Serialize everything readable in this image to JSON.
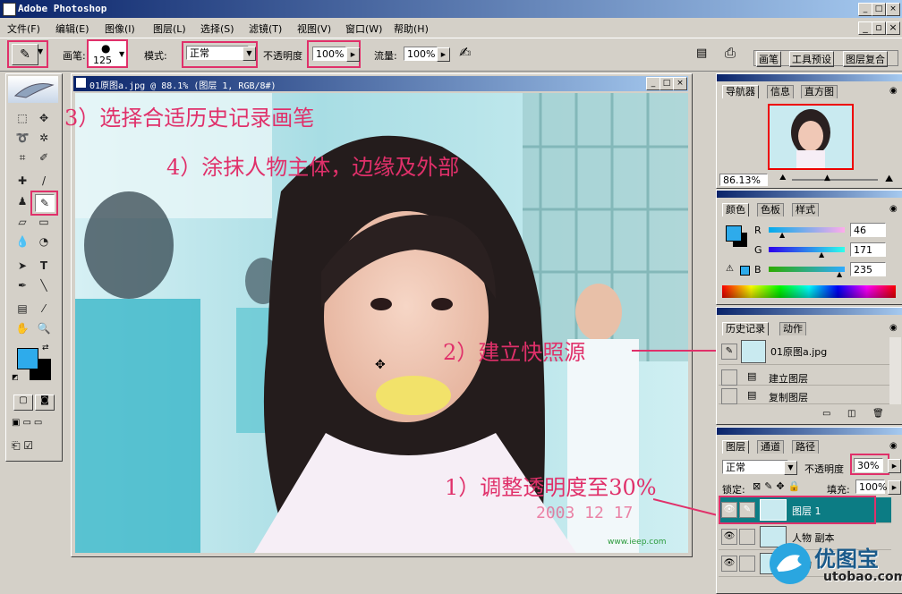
{
  "window": {
    "title": "Adobe Photoshop"
  },
  "menu": [
    "文件(F)",
    "编辑(E)",
    "图像(I)",
    "图层(L)",
    "选择(S)",
    "滤镜(T)",
    "视图(V)",
    "窗口(W)",
    "帮助(H)"
  ],
  "options": {
    "brush_label": "画笔:",
    "brush_size": "125",
    "mode_label": "模式:",
    "mode_value": "正常",
    "opacity_label": "不透明度",
    "opacity_value": "100%",
    "flow_label": "流量:",
    "flow_value": "100%",
    "tabs": [
      "画笔",
      "工具预设",
      "图层复合"
    ]
  },
  "document": {
    "title": "01原图a.jpg @ 88.1% (图层 1, RGB/8#)",
    "watermark_date": "2003  12  17",
    "watermark_site": "www.ieep.com"
  },
  "navigator": {
    "tabs": [
      "导航器",
      "信息",
      "直方图"
    ],
    "zoom": "86.13%"
  },
  "color": {
    "tabs": [
      "颜色",
      "色板",
      "样式"
    ],
    "r_label": "R",
    "g_label": "G",
    "b_label": "B",
    "r": "46",
    "g": "171",
    "b": "235",
    "fg": "#2eabeb"
  },
  "history": {
    "tabs": [
      "历史记录",
      "动作"
    ],
    "snapshot": "01原图a.jpg",
    "items": [
      "建立图层",
      "复制图层"
    ]
  },
  "layers": {
    "tabs": [
      "图层",
      "通道",
      "路径"
    ],
    "mode": "正常",
    "opacity_label": "不透明度",
    "opacity": "30%",
    "lock_label": "锁定:",
    "fill_label": "填充:",
    "fill": "100%",
    "items": [
      "图层 1",
      "人物 副本",
      "人物"
    ]
  },
  "annotations": {
    "step1": "1）调整透明度至30%",
    "step2": "2）建立快照源",
    "step3": "3）选择合适历史记录画笔",
    "step4": "4）涂抹人物主体，边缘及外部"
  },
  "logo": {
    "name": "优图宝",
    "url": "utobao.com"
  },
  "accent": "#e0306a"
}
